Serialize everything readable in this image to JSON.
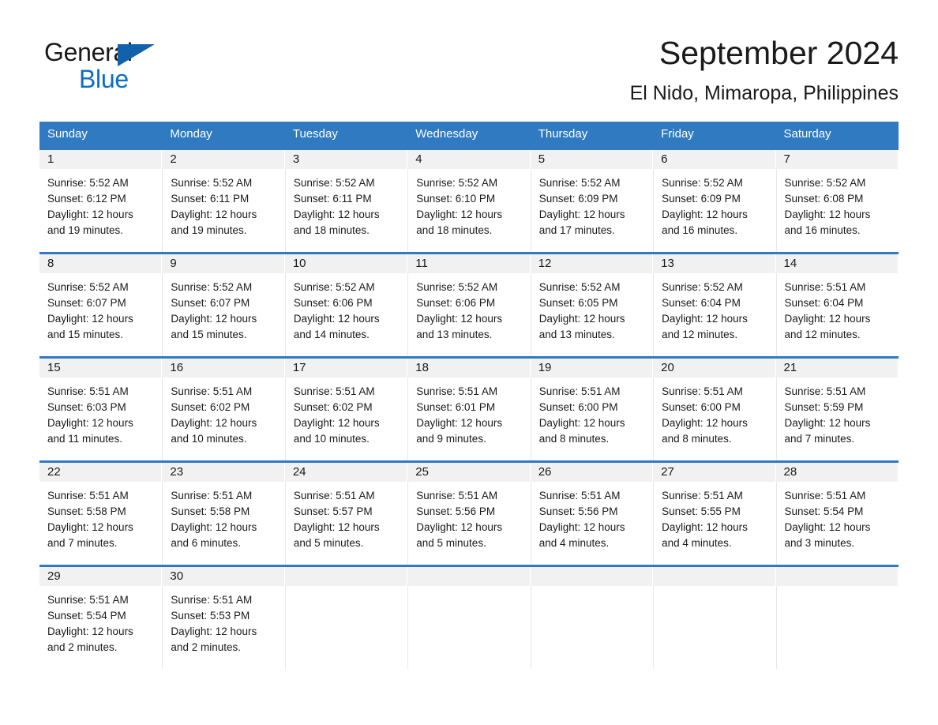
{
  "logo": {
    "word_one": "General",
    "word_two": "Blue",
    "triangle_color": "#1161ab",
    "blue_color": "#0b6ec4"
  },
  "header": {
    "month_title": "September 2024",
    "location": "El Nido, Mimaropa, Philippines"
  },
  "theme": {
    "header_blue": "#2f7ac0",
    "daynum_band": "#f1f1f1",
    "text": "#1a1a1a"
  },
  "calendar": {
    "weekday_headers": [
      "Sunday",
      "Monday",
      "Tuesday",
      "Wednesday",
      "Thursday",
      "Friday",
      "Saturday"
    ],
    "weeks": [
      [
        {
          "day": "1",
          "sunrise": "Sunrise: 5:52 AM",
          "sunset": "Sunset: 6:12 PM",
          "daylight_line1": "Daylight: 12 hours",
          "daylight_line2": "and 19 minutes."
        },
        {
          "day": "2",
          "sunrise": "Sunrise: 5:52 AM",
          "sunset": "Sunset: 6:11 PM",
          "daylight_line1": "Daylight: 12 hours",
          "daylight_line2": "and 19 minutes."
        },
        {
          "day": "3",
          "sunrise": "Sunrise: 5:52 AM",
          "sunset": "Sunset: 6:11 PM",
          "daylight_line1": "Daylight: 12 hours",
          "daylight_line2": "and 18 minutes."
        },
        {
          "day": "4",
          "sunrise": "Sunrise: 5:52 AM",
          "sunset": "Sunset: 6:10 PM",
          "daylight_line1": "Daylight: 12 hours",
          "daylight_line2": "and 18 minutes."
        },
        {
          "day": "5",
          "sunrise": "Sunrise: 5:52 AM",
          "sunset": "Sunset: 6:09 PM",
          "daylight_line1": "Daylight: 12 hours",
          "daylight_line2": "and 17 minutes."
        },
        {
          "day": "6",
          "sunrise": "Sunrise: 5:52 AM",
          "sunset": "Sunset: 6:09 PM",
          "daylight_line1": "Daylight: 12 hours",
          "daylight_line2": "and 16 minutes."
        },
        {
          "day": "7",
          "sunrise": "Sunrise: 5:52 AM",
          "sunset": "Sunset: 6:08 PM",
          "daylight_line1": "Daylight: 12 hours",
          "daylight_line2": "and 16 minutes."
        }
      ],
      [
        {
          "day": "8",
          "sunrise": "Sunrise: 5:52 AM",
          "sunset": "Sunset: 6:07 PM",
          "daylight_line1": "Daylight: 12 hours",
          "daylight_line2": "and 15 minutes."
        },
        {
          "day": "9",
          "sunrise": "Sunrise: 5:52 AM",
          "sunset": "Sunset: 6:07 PM",
          "daylight_line1": "Daylight: 12 hours",
          "daylight_line2": "and 15 minutes."
        },
        {
          "day": "10",
          "sunrise": "Sunrise: 5:52 AM",
          "sunset": "Sunset: 6:06 PM",
          "daylight_line1": "Daylight: 12 hours",
          "daylight_line2": "and 14 minutes."
        },
        {
          "day": "11",
          "sunrise": "Sunrise: 5:52 AM",
          "sunset": "Sunset: 6:06 PM",
          "daylight_line1": "Daylight: 12 hours",
          "daylight_line2": "and 13 minutes."
        },
        {
          "day": "12",
          "sunrise": "Sunrise: 5:52 AM",
          "sunset": "Sunset: 6:05 PM",
          "daylight_line1": "Daylight: 12 hours",
          "daylight_line2": "and 13 minutes."
        },
        {
          "day": "13",
          "sunrise": "Sunrise: 5:52 AM",
          "sunset": "Sunset: 6:04 PM",
          "daylight_line1": "Daylight: 12 hours",
          "daylight_line2": "and 12 minutes."
        },
        {
          "day": "14",
          "sunrise": "Sunrise: 5:51 AM",
          "sunset": "Sunset: 6:04 PM",
          "daylight_line1": "Daylight: 12 hours",
          "daylight_line2": "and 12 minutes."
        }
      ],
      [
        {
          "day": "15",
          "sunrise": "Sunrise: 5:51 AM",
          "sunset": "Sunset: 6:03 PM",
          "daylight_line1": "Daylight: 12 hours",
          "daylight_line2": "and 11 minutes."
        },
        {
          "day": "16",
          "sunrise": "Sunrise: 5:51 AM",
          "sunset": "Sunset: 6:02 PM",
          "daylight_line1": "Daylight: 12 hours",
          "daylight_line2": "and 10 minutes."
        },
        {
          "day": "17",
          "sunrise": "Sunrise: 5:51 AM",
          "sunset": "Sunset: 6:02 PM",
          "daylight_line1": "Daylight: 12 hours",
          "daylight_line2": "and 10 minutes."
        },
        {
          "day": "18",
          "sunrise": "Sunrise: 5:51 AM",
          "sunset": "Sunset: 6:01 PM",
          "daylight_line1": "Daylight: 12 hours",
          "daylight_line2": "and 9 minutes."
        },
        {
          "day": "19",
          "sunrise": "Sunrise: 5:51 AM",
          "sunset": "Sunset: 6:00 PM",
          "daylight_line1": "Daylight: 12 hours",
          "daylight_line2": "and 8 minutes."
        },
        {
          "day": "20",
          "sunrise": "Sunrise: 5:51 AM",
          "sunset": "Sunset: 6:00 PM",
          "daylight_line1": "Daylight: 12 hours",
          "daylight_line2": "and 8 minutes."
        },
        {
          "day": "21",
          "sunrise": "Sunrise: 5:51 AM",
          "sunset": "Sunset: 5:59 PM",
          "daylight_line1": "Daylight: 12 hours",
          "daylight_line2": "and 7 minutes."
        }
      ],
      [
        {
          "day": "22",
          "sunrise": "Sunrise: 5:51 AM",
          "sunset": "Sunset: 5:58 PM",
          "daylight_line1": "Daylight: 12 hours",
          "daylight_line2": "and 7 minutes."
        },
        {
          "day": "23",
          "sunrise": "Sunrise: 5:51 AM",
          "sunset": "Sunset: 5:58 PM",
          "daylight_line1": "Daylight: 12 hours",
          "daylight_line2": "and 6 minutes."
        },
        {
          "day": "24",
          "sunrise": "Sunrise: 5:51 AM",
          "sunset": "Sunset: 5:57 PM",
          "daylight_line1": "Daylight: 12 hours",
          "daylight_line2": "and 5 minutes."
        },
        {
          "day": "25",
          "sunrise": "Sunrise: 5:51 AM",
          "sunset": "Sunset: 5:56 PM",
          "daylight_line1": "Daylight: 12 hours",
          "daylight_line2": "and 5 minutes."
        },
        {
          "day": "26",
          "sunrise": "Sunrise: 5:51 AM",
          "sunset": "Sunset: 5:56 PM",
          "daylight_line1": "Daylight: 12 hours",
          "daylight_line2": "and 4 minutes."
        },
        {
          "day": "27",
          "sunrise": "Sunrise: 5:51 AM",
          "sunset": "Sunset: 5:55 PM",
          "daylight_line1": "Daylight: 12 hours",
          "daylight_line2": "and 4 minutes."
        },
        {
          "day": "28",
          "sunrise": "Sunrise: 5:51 AM",
          "sunset": "Sunset: 5:54 PM",
          "daylight_line1": "Daylight: 12 hours",
          "daylight_line2": "and 3 minutes."
        }
      ],
      [
        {
          "day": "29",
          "sunrise": "Sunrise: 5:51 AM",
          "sunset": "Sunset: 5:54 PM",
          "daylight_line1": "Daylight: 12 hours",
          "daylight_line2": "and 2 minutes."
        },
        {
          "day": "30",
          "sunrise": "Sunrise: 5:51 AM",
          "sunset": "Sunset: 5:53 PM",
          "daylight_line1": "Daylight: 12 hours",
          "daylight_line2": "and 2 minutes."
        },
        {
          "day": "",
          "sunrise": "",
          "sunset": "",
          "daylight_line1": "",
          "daylight_line2": ""
        },
        {
          "day": "",
          "sunrise": "",
          "sunset": "",
          "daylight_line1": "",
          "daylight_line2": ""
        },
        {
          "day": "",
          "sunrise": "",
          "sunset": "",
          "daylight_line1": "",
          "daylight_line2": ""
        },
        {
          "day": "",
          "sunrise": "",
          "sunset": "",
          "daylight_line1": "",
          "daylight_line2": ""
        },
        {
          "day": "",
          "sunrise": "",
          "sunset": "",
          "daylight_line1": "",
          "daylight_line2": ""
        }
      ]
    ]
  }
}
